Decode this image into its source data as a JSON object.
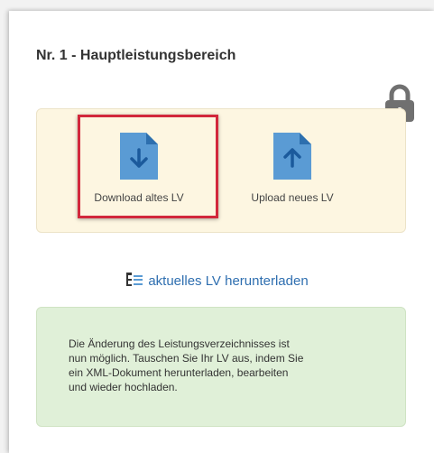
{
  "panel": {
    "title": "Nr. 1 - Hauptleistungsbereich"
  },
  "actions": {
    "download_label": "Download altes LV",
    "upload_label": "Upload neues LV"
  },
  "link": {
    "label": "aktuelles LV herunterladen"
  },
  "info": {
    "lines": [
      "Die Änderung des Leistungsverzeichnisses ist",
      "nun möglich. Tauschen Sie Ihr LV aus, indem Sie",
      "ein XML-Dokument herunterladen, bearbeiten",
      "und wieder hochladen."
    ]
  },
  "icons": {
    "lock": "lock-icon",
    "download": "file-download-icon",
    "upload": "file-upload-icon",
    "tree": "list-tree-icon"
  },
  "colors": {
    "highlight": "#d2283c",
    "file_icon": "#5a9bd4",
    "link": "#2f6fb0",
    "file_box_bg": "#fdf6e1",
    "info_bg": "#e0f0d8",
    "lock": "#707070"
  }
}
